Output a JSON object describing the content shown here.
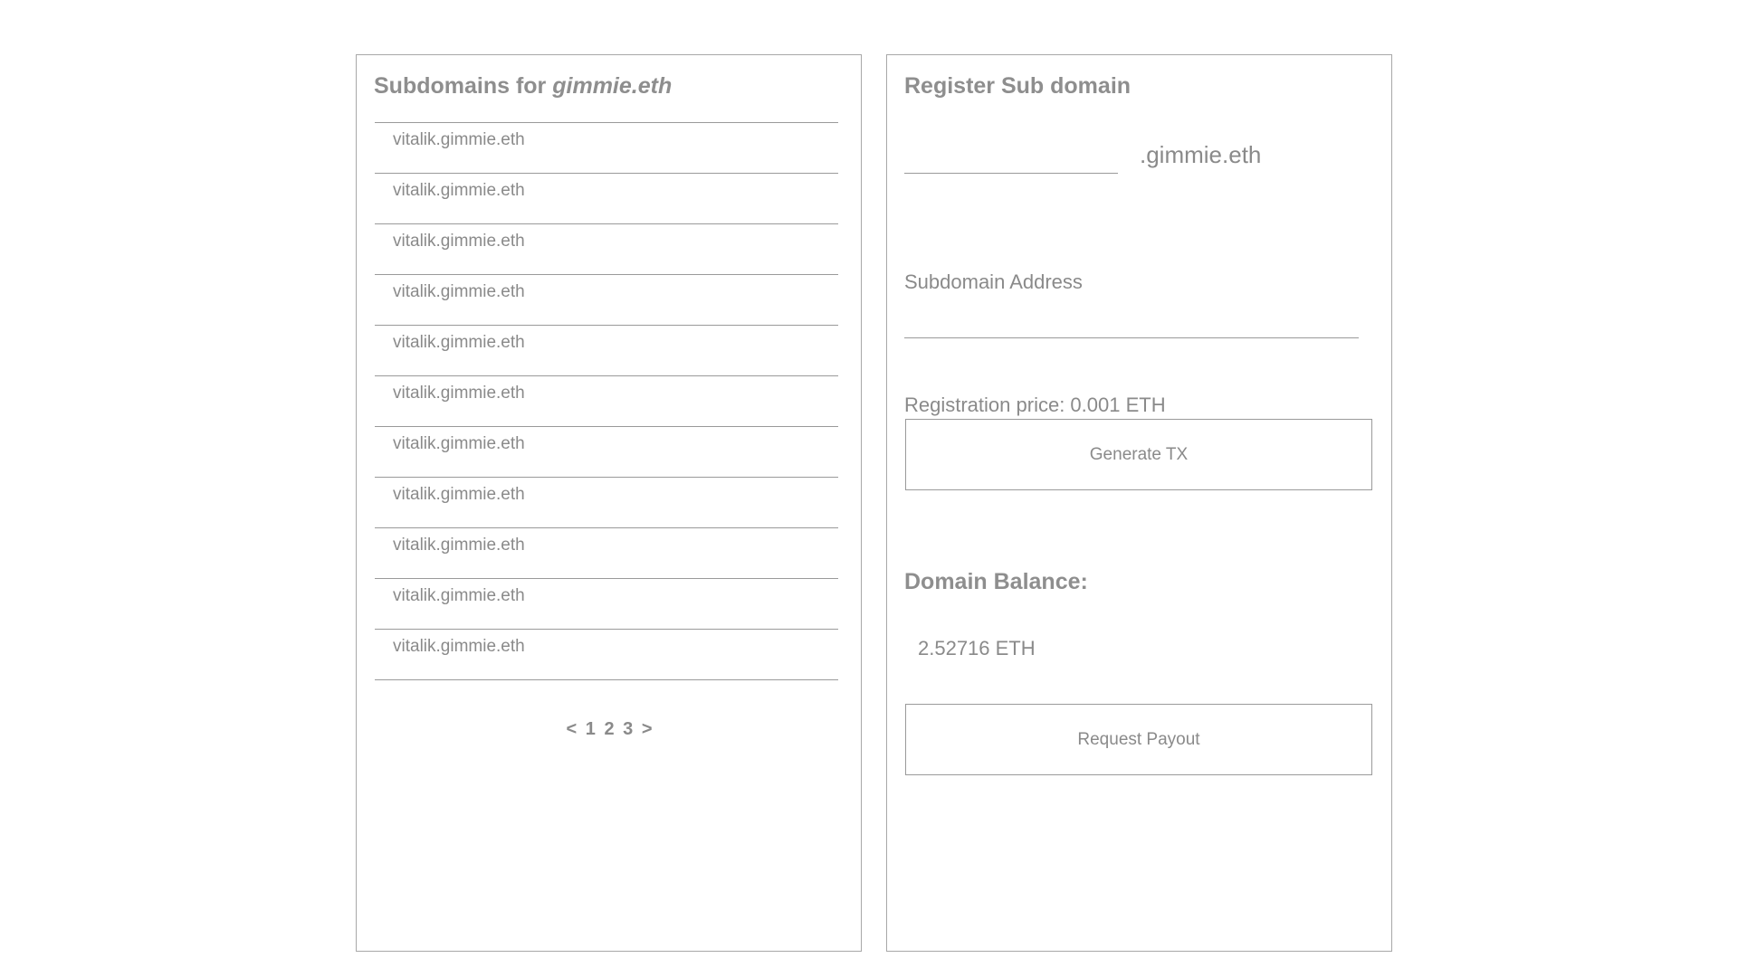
{
  "left_panel": {
    "title_prefix": "Subdomains for",
    "title_domain": "gimmie.eth",
    "subdomains": [
      "vitalik.gimmie.eth",
      "vitalik.gimmie.eth",
      "vitalik.gimmie.eth",
      "vitalik.gimmie.eth",
      "vitalik.gimmie.eth",
      "vitalik.gimmie.eth",
      "vitalik.gimmie.eth",
      "vitalik.gimmie.eth",
      "vitalik.gimmie.eth",
      "vitalik.gimmie.eth",
      "vitalik.gimmie.eth"
    ],
    "pagination": {
      "prev": "<",
      "pages": [
        "1",
        "2",
        "3"
      ],
      "next": ">"
    }
  },
  "right_panel": {
    "title": "Register Sub domain",
    "subdomain_input_value": "",
    "domain_suffix": ".gimmie.eth",
    "address_label": "Subdomain Address",
    "address_input_value": "",
    "price_text": "Registration price: 0.001 ETH",
    "generate_button_label": "Generate TX",
    "balance_heading": "Domain Balance:",
    "balance_value": "2.52716 ETH",
    "payout_button_label": "Request Payout"
  },
  "colors": {
    "text": "#8a8a8a",
    "border": "#a8a8a8",
    "background": "#ffffff"
  }
}
